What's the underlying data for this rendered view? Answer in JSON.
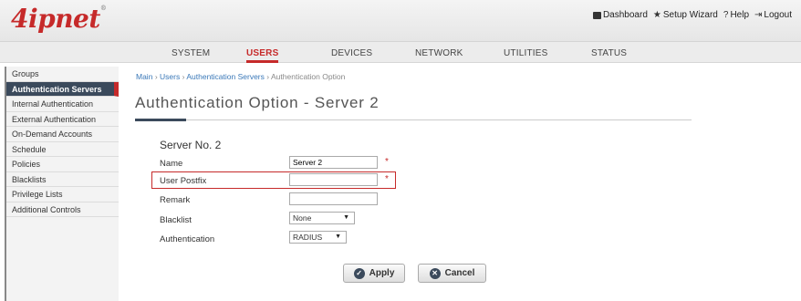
{
  "brand": {
    "logo": "4ipnet",
    "mark": "®"
  },
  "toplinks": [
    {
      "icon": "dashboard-icon",
      "label": "Dashboard"
    },
    {
      "icon": "star-icon",
      "label": "Setup Wizard"
    },
    {
      "icon": "help-icon",
      "label": "Help"
    },
    {
      "icon": "logout-icon",
      "label": "Logout"
    }
  ],
  "nav": {
    "tabs": [
      "SYSTEM",
      "USERS",
      "DEVICES",
      "NETWORK",
      "UTILITIES",
      "STATUS"
    ],
    "active": "USERS"
  },
  "sidebar": {
    "items": [
      "Groups",
      "Authentication Servers",
      "Internal Authentication",
      "External Authentication",
      "On-Demand Accounts",
      "Schedule",
      "Policies",
      "Blacklists",
      "Privilege Lists",
      "Additional Controls"
    ],
    "active": "Authentication Servers"
  },
  "breadcrumb": {
    "items": [
      "Main",
      "Users",
      "Authentication Servers",
      "Authentication Option"
    ],
    "separator": "›"
  },
  "page": {
    "title": "Authentication Option - Server 2"
  },
  "form": {
    "section_title": "Server No. 2",
    "name_label": "Name",
    "name_value": "Server 2",
    "postfix_label": "User Postfix",
    "postfix_value": "",
    "remark_label": "Remark",
    "remark_value": "",
    "required_mark": "*",
    "blacklist_label": "Blacklist",
    "blacklist_value": "None",
    "auth_label": "Authentication",
    "auth_value": "RADIUS"
  },
  "actions": {
    "apply": "Apply",
    "cancel": "Cancel"
  },
  "colors": {
    "brand_red": "#c62a2a",
    "active_bg": "#3b4a5c",
    "link": "#3a78b8"
  }
}
